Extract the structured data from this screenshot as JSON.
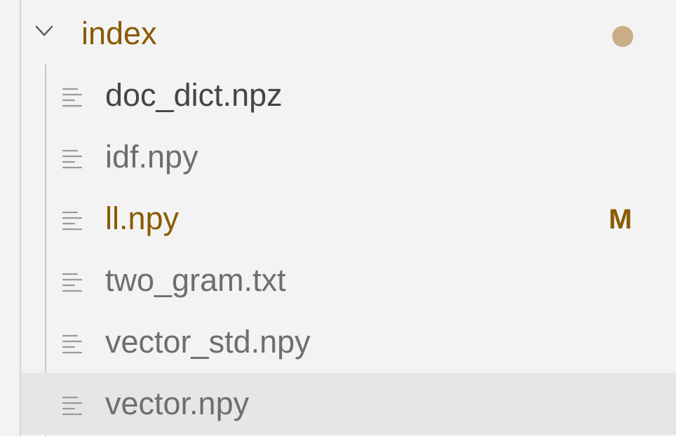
{
  "explorer": {
    "folder": {
      "name": "index",
      "expanded": true,
      "chevron_icon": "chevron-down-icon",
      "dot_color": "#c9ad86",
      "label_color": "#8a5a00"
    },
    "files": [
      {
        "name": "doc_dict.npz",
        "icon": "file-lines-icon",
        "color": "#454545",
        "status": ""
      },
      {
        "name": "idf.npy",
        "icon": "file-lines-icon",
        "color": "#6e6e6e",
        "status": ""
      },
      {
        "name": "ll.npy",
        "icon": "file-lines-icon",
        "color": "#8a5a00",
        "status": "M",
        "status_color": "#8a5a00"
      },
      {
        "name": "two_gram.txt",
        "icon": "file-lines-icon",
        "color": "#6e6e6e",
        "status": ""
      },
      {
        "name": "vector_std.npy",
        "icon": "file-lines-icon",
        "color": "#6e6e6e",
        "status": ""
      },
      {
        "name": "vector.npy",
        "icon": "file-lines-icon",
        "color": "#6e6e6e",
        "status": "",
        "selected": true
      }
    ]
  }
}
